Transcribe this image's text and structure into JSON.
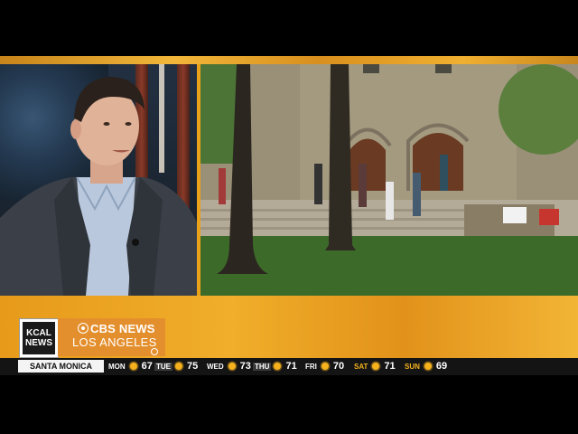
{
  "branding": {
    "logo_kcal_line1": "KCAL",
    "logo_kcal_line2": "NEWS",
    "cbs_name": "CBS NEWS",
    "cbs_city": "LOS ANGELES"
  },
  "weather": {
    "location": "SANTA MONICA",
    "days": [
      {
        "name": "MON",
        "temp": "67",
        "icon": "sun-icon"
      },
      {
        "name": "TUE",
        "temp": "75",
        "icon": "sun-icon"
      },
      {
        "name": "WED",
        "temp": "73",
        "icon": "sun-icon"
      },
      {
        "name": "THU",
        "temp": "71",
        "icon": "sun-icon"
      },
      {
        "name": "FRI",
        "temp": "70",
        "icon": "sun-icon"
      },
      {
        "name": "SAT",
        "temp": "71",
        "icon": "sun-icon"
      },
      {
        "name": "SUN",
        "temp": "69",
        "icon": "sun-icon"
      }
    ]
  },
  "colors": {
    "accent_orange": "#e9a21a",
    "cbs_box": "#e48f2e",
    "ticker_bg": "#141414"
  }
}
